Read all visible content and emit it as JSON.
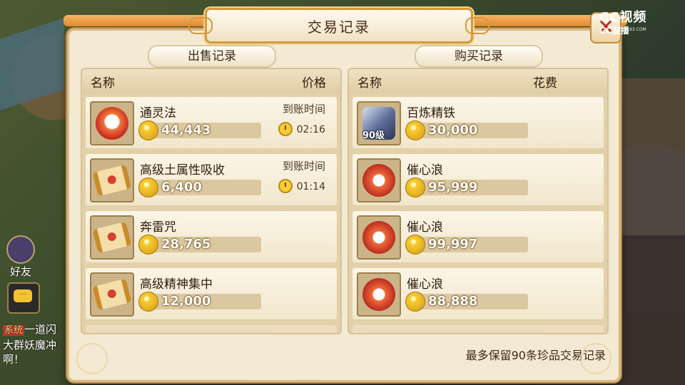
{
  "dialog": {
    "title": "交易记录",
    "close_label": "✕"
  },
  "watermark": {
    "brand_top": "CC视频",
    "brand_bottom": "CC直播",
    "url": "CC.163.COM"
  },
  "side_ui": {
    "friend_label": "好友",
    "chat_lines": {
      "tag": "系统",
      "line1": "一道闪",
      "line2": "大群妖魔冲",
      "line3": "啊！"
    }
  },
  "sell": {
    "section_label": "出售记录",
    "col_name": "名称",
    "col_price": "价格",
    "items": [
      {
        "name": "通灵法",
        "price": "44,443",
        "arrival_label": "到账时间",
        "timer": "02:16",
        "icon": "spirit-orb-icon"
      },
      {
        "name": "高级土属性吸收",
        "price": "6,400",
        "arrival_label": "到账时间",
        "timer": "01:14",
        "icon": "scroll-icon"
      },
      {
        "name": "奔雷咒",
        "price": "28,765",
        "icon": "scroll-icon"
      },
      {
        "name": "高级精神集中",
        "price": "12,000",
        "icon": "scroll-icon"
      }
    ]
  },
  "buy": {
    "section_label": "购买记录",
    "col_name": "名称",
    "col_cost": "花费",
    "items": [
      {
        "name": "百炼精铁",
        "price": "30,000",
        "level": "90级",
        "icon": "iron-ore-icon"
      },
      {
        "name": "催心浪",
        "price": "95,999",
        "icon": "wave-orb-icon"
      },
      {
        "name": "催心浪",
        "price": "99,997",
        "icon": "wave-orb-icon"
      },
      {
        "name": "催心浪",
        "price": "88,888",
        "icon": "wave-orb-icon"
      }
    ]
  },
  "footer_note": "最多保留90条珍品交易记录",
  "colors": {
    "panel_bg": "#f4ead3",
    "title_border": "#d39a3e",
    "coin": "#f7cd34"
  }
}
